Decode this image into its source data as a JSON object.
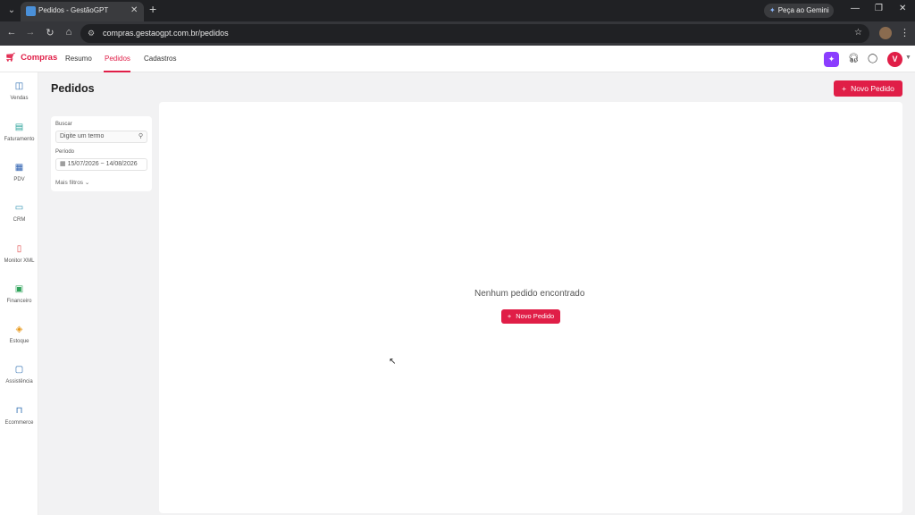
{
  "browser": {
    "tab_title": "Pedidos - GestãoGPT",
    "url": "compras.gestaogpt.com.br/pedidos",
    "gemini_label": "Peça ao Gemini"
  },
  "app": {
    "brand": "Compras",
    "nav": [
      {
        "label": "Resumo"
      },
      {
        "label": "Pedidos"
      },
      {
        "label": "Cadastros"
      }
    ],
    "active_nav": "Pedidos",
    "user_initial": "V",
    "accent_color": "#e01e47"
  },
  "sidebar": {
    "items": [
      {
        "label": "Vendas",
        "icon": "basket-icon"
      },
      {
        "label": "Faturamento",
        "icon": "invoice-icon"
      },
      {
        "label": "PDV",
        "icon": "store-icon"
      },
      {
        "label": "CRM",
        "icon": "chat-icon"
      },
      {
        "label": "Monitor XML",
        "icon": "xml-file-icon"
      },
      {
        "label": "Financeiro",
        "icon": "money-icon"
      },
      {
        "label": "Estoque",
        "icon": "boxes-icon"
      },
      {
        "label": "Assistência",
        "icon": "service-icon"
      },
      {
        "label": "Ecommerce",
        "icon": "shopping-bag-icon"
      }
    ]
  },
  "page": {
    "title": "Pedidos",
    "new_button": "Novo Pedido",
    "empty_message": "Nenhum pedido encontrado",
    "empty_button": "Novo Pedido"
  },
  "filters": {
    "search_label": "Buscar",
    "search_placeholder": "Digite um termo",
    "period_label": "Período",
    "period_value": "15/07/2026 ~ 14/08/2026",
    "more_filters": "Mais filtros"
  }
}
